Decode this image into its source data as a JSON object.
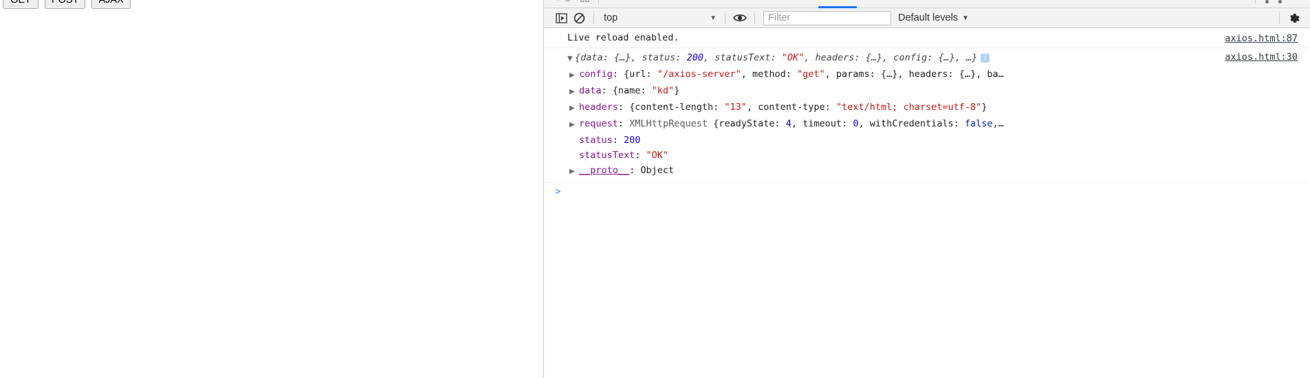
{
  "page": {
    "buttons": [
      {
        "label": "GET",
        "name": "get-button"
      },
      {
        "label": "POST",
        "name": "post-button"
      },
      {
        "label": "AJAX",
        "name": "ajax-button"
      }
    ]
  },
  "devtools": {
    "toolbar": {
      "sidebar_toggle_icon": "console-sidebar-toggle-icon",
      "clear_console_icon": "clear-console-icon",
      "context": "top",
      "context_caret": "▼",
      "eye_icon": "live-expression-eye-icon",
      "filter_placeholder": "Filter",
      "filter_value": "",
      "levels_label": "Default levels",
      "levels_caret": "▼",
      "settings_icon": "gear-icon"
    },
    "accent_color": "#1a73e8"
  },
  "console": {
    "messages": [
      {
        "text": "Live reload enabled.",
        "source": "axios.html:87"
      }
    ],
    "object_log": {
      "source": "axios.html:30",
      "summary": {
        "triangle": "▼",
        "parts": [
          {
            "t": "{data: {…}, status: ",
            "c": "k-dim"
          },
          {
            "t": "200",
            "c": "i-num"
          },
          {
            "t": ", statusText: ",
            "c": "k-dim"
          },
          {
            "t": "\"OK\"",
            "c": "i-str"
          },
          {
            "t": ", headers: {…}, config: {…}, …}",
            "c": "k-dim"
          }
        ],
        "badge": "i"
      },
      "properties": [
        {
          "triangle": "▶",
          "parts": [
            {
              "t": "config",
              "c": "k-prop"
            },
            {
              "t": ": {url: ",
              "c": "k-plain"
            },
            {
              "t": "\"/axios-server\"",
              "c": "k-str"
            },
            {
              "t": ", method: ",
              "c": "k-plain"
            },
            {
              "t": "\"get\"",
              "c": "k-str"
            },
            {
              "t": ", params: {…}, headers: {…}, ba…",
              "c": "k-plain"
            }
          ]
        },
        {
          "triangle": "▶",
          "parts": [
            {
              "t": "data",
              "c": "k-prop"
            },
            {
              "t": ": {name: ",
              "c": "k-plain"
            },
            {
              "t": "\"kd\"",
              "c": "k-str"
            },
            {
              "t": "}",
              "c": "k-plain"
            }
          ]
        },
        {
          "triangle": "▶",
          "parts": [
            {
              "t": "headers",
              "c": "k-prop"
            },
            {
              "t": ": {content-length: ",
              "c": "k-plain"
            },
            {
              "t": "\"13\"",
              "c": "k-str"
            },
            {
              "t": ", content-type: ",
              "c": "k-plain"
            },
            {
              "t": "\"text/html; charset=utf-8\"",
              "c": "k-str"
            },
            {
              "t": "}",
              "c": "k-plain"
            }
          ]
        },
        {
          "triangle": "▶",
          "parts": [
            {
              "t": "request",
              "c": "k-prop"
            },
            {
              "t": ": ",
              "c": "k-plain"
            },
            {
              "t": "XMLHttpRequest",
              "c": "k-class"
            },
            {
              "t": " {readyState: ",
              "c": "k-plain"
            },
            {
              "t": "4",
              "c": "k-num"
            },
            {
              "t": ", timeout: ",
              "c": "k-plain"
            },
            {
              "t": "0",
              "c": "k-num"
            },
            {
              "t": ", withCredentials: ",
              "c": "k-plain"
            },
            {
              "t": "false",
              "c": "k-bool"
            },
            {
              "t": ",…",
              "c": "k-plain"
            }
          ]
        },
        {
          "triangle": "",
          "parts": [
            {
              "t": "status",
              "c": "k-prop"
            },
            {
              "t": ": ",
              "c": "k-plain"
            },
            {
              "t": "200",
              "c": "k-num"
            }
          ]
        },
        {
          "triangle": "",
          "parts": [
            {
              "t": "statusText",
              "c": "k-prop"
            },
            {
              "t": ": ",
              "c": "k-plain"
            },
            {
              "t": "\"OK\"",
              "c": "k-str"
            }
          ]
        },
        {
          "triangle": "▶",
          "parts": [
            {
              "t": "__proto__",
              "c": "k-proto"
            },
            {
              "t": ": ",
              "c": "k-plain"
            },
            {
              "t": "Object",
              "c": "k-plain"
            }
          ]
        }
      ]
    },
    "prompt": ">"
  }
}
